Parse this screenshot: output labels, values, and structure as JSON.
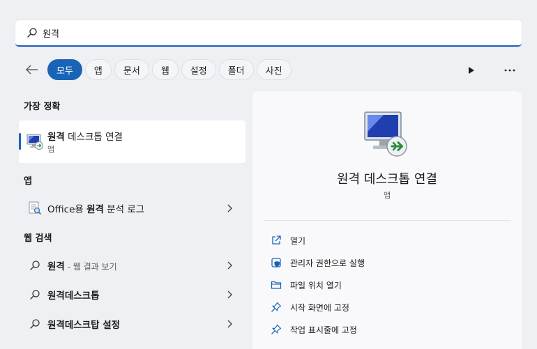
{
  "search": {
    "query": "원격"
  },
  "filters": {
    "items": [
      "모두",
      "앱",
      "문서",
      "웹",
      "설정",
      "폴더",
      "사진"
    ],
    "active_index": 0
  },
  "sections": {
    "best_match": "가장 정확",
    "apps": "앱",
    "web_search": "웹 검색"
  },
  "best_match": {
    "title_bold": "원격",
    "title_rest": " 데스크톱 연결",
    "subtitle": "앱"
  },
  "apps": [
    {
      "prefix": "Office용 ",
      "bold": "원격",
      "suffix": " 분석 로그"
    }
  ],
  "web_results": [
    {
      "bold": "원격",
      "muted": " - 웹 결과 보기"
    },
    {
      "bold": "원격데스크톱",
      "muted": ""
    },
    {
      "bold": "원격데스크탑 설정",
      "muted": ""
    }
  ],
  "detail": {
    "title": "원격 데스크톱 연결",
    "subtitle": "앱",
    "actions": [
      {
        "label": "열기",
        "icon": "open-icon"
      },
      {
        "label": "관리자 권한으로 실행",
        "icon": "shield-icon"
      },
      {
        "label": "파일 위치 열기",
        "icon": "folder-icon"
      },
      {
        "label": "시작 화면에 고정",
        "icon": "pin-icon"
      },
      {
        "label": "작업 표시줄에 고정",
        "icon": "pin-icon"
      }
    ]
  },
  "colors": {
    "accent": "#1a64b8",
    "background": "#eef0f4"
  }
}
